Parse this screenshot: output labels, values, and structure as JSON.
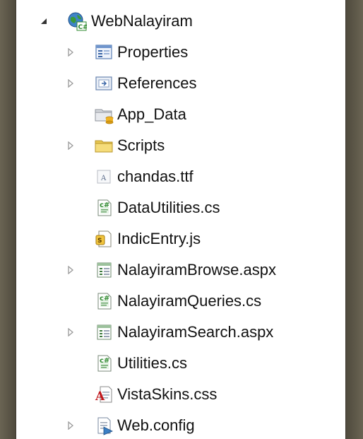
{
  "solution_explorer": {
    "root": {
      "label": "WebNalayiram",
      "icon": "web-project-icon",
      "expanded": true
    },
    "items": [
      {
        "label": "Properties",
        "icon": "properties-icon",
        "expandable": true
      },
      {
        "label": "References",
        "icon": "references-icon",
        "expandable": true
      },
      {
        "label": "App_Data",
        "icon": "app-data-folder-icon",
        "expandable": false
      },
      {
        "label": "Scripts",
        "icon": "folder-icon",
        "expandable": true
      },
      {
        "label": "chandas.ttf",
        "icon": "font-file-icon",
        "expandable": false
      },
      {
        "label": "DataUtilities.cs",
        "icon": "csharp-file-icon",
        "expandable": false
      },
      {
        "label": "IndicEntry.js",
        "icon": "javascript-file-icon",
        "expandable": false
      },
      {
        "label": "NalayiramBrowse.aspx",
        "icon": "aspx-page-icon",
        "expandable": true
      },
      {
        "label": "NalayiramQueries.cs",
        "icon": "csharp-file-icon",
        "expandable": false
      },
      {
        "label": "NalayiramSearch.aspx",
        "icon": "aspx-page-icon",
        "expandable": true
      },
      {
        "label": "Utilities.cs",
        "icon": "csharp-file-icon",
        "expandable": false
      },
      {
        "label": "VistaSkins.css",
        "icon": "css-file-icon",
        "expandable": false
      },
      {
        "label": "Web.config",
        "icon": "config-file-icon",
        "expandable": true
      }
    ]
  },
  "colors": {
    "panel_bg": "#ffffff",
    "frame_bg": "#5b5546",
    "text": "#111111",
    "expander": "#9a9a9a",
    "folder_yellow": "#f2d56a",
    "csharp_green": "#2f8a2f"
  }
}
